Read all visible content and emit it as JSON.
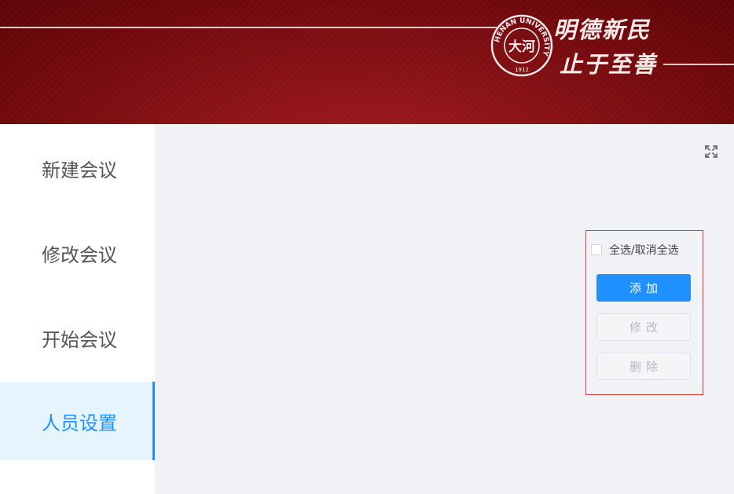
{
  "header": {
    "motto_line1": "明德新民",
    "motto_line2": "止于至善",
    "seal": {
      "center_text": "大河",
      "ring_text": "HENAN UNIVERSITY",
      "year": "1912"
    }
  },
  "sidebar": {
    "items": [
      {
        "label": "新建会议",
        "active": false
      },
      {
        "label": "修改会议",
        "active": false
      },
      {
        "label": "开始会议",
        "active": false
      },
      {
        "label": "人员设置",
        "active": true
      }
    ]
  },
  "toolbar": {
    "fullscreen_icon": "fullscreen-icon"
  },
  "panel": {
    "select_all_label": "全选/取消全选",
    "select_all_checked": false,
    "add_label": "添加",
    "edit_label": "修改",
    "delete_label": "删除"
  },
  "colors": {
    "header_red": "#8a1216",
    "accent_blue": "#1e90ff",
    "active_bg": "#e6f4fd",
    "panel_border": "#e23838",
    "main_bg": "#f0f2f5"
  }
}
